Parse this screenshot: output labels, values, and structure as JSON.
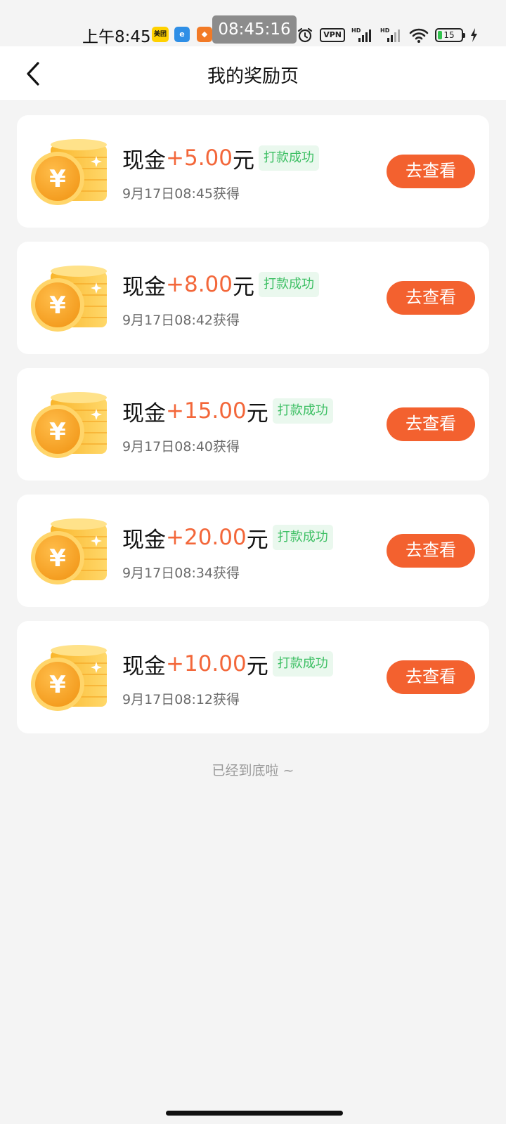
{
  "status_bar": {
    "time": "上午8:45",
    "screen_clock": "08:45:16",
    "app_badges": [
      "美团",
      "e",
      "◆"
    ],
    "vpn_label": "VPN",
    "battery_level": "15",
    "battery_color": "#32c24d"
  },
  "header": {
    "title": "我的奖励页"
  },
  "rewards": [
    {
      "type": "现金",
      "amount": "+5.00",
      "unit": "元",
      "status": "打款成功",
      "time": "9月17日08:45获得",
      "action": "去查看"
    },
    {
      "type": "现金",
      "amount": "+8.00",
      "unit": "元",
      "status": "打款成功",
      "time": "9月17日08:42获得",
      "action": "去查看"
    },
    {
      "type": "现金",
      "amount": "+15.00",
      "unit": "元",
      "status": "打款成功",
      "time": "9月17日08:40获得",
      "action": "去查看"
    },
    {
      "type": "现金",
      "amount": "+20.00",
      "unit": "元",
      "status": "打款成功",
      "time": "9月17日08:34获得",
      "action": "去查看"
    },
    {
      "type": "现金",
      "amount": "+10.00",
      "unit": "元",
      "status": "打款成功",
      "time": "9月17日08:12获得",
      "action": "去查看"
    }
  ],
  "list_end_text": "已经到底啦 ~",
  "colors": {
    "accent": "#f3612f",
    "amount": "#f3673a",
    "success_text": "#3cbf63",
    "success_bg": "#eaf8ee",
    "page_bg": "#f4f4f4"
  }
}
